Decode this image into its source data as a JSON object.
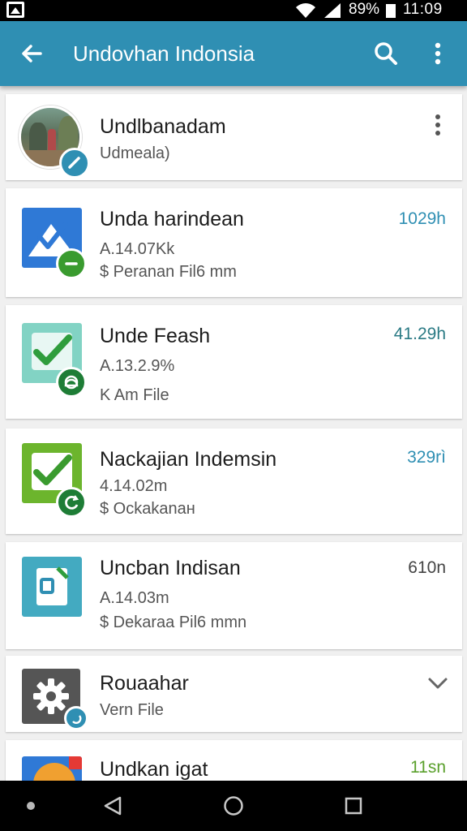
{
  "status_bar": {
    "battery_percent": "89%",
    "time": "11:09"
  },
  "app_bar": {
    "title": "Undovhan Indonsia",
    "back_icon": "arrow-back-icon",
    "search_icon": "search-icon",
    "more_icon": "more-vert-icon"
  },
  "account": {
    "name": "Undlbanadam",
    "subtitle": "Udmeala)"
  },
  "apps": [
    {
      "name": "Unda harindean",
      "line1": "A.14.07Kk",
      "line2": "$ Peranan Fil6 mm",
      "size": "1029h",
      "size_color": "#2f8fb3",
      "icon_color": "#2f79d6",
      "badge_color": "#3a9b2f"
    },
    {
      "name": "Unde Feash",
      "line1": "A.13.2.9%",
      "line2": "K Am File",
      "size": "41.29h",
      "size_color": "#2a7a84",
      "icon_color": "#82d3c4",
      "badge_color": "#1e7d36"
    },
    {
      "name": "Nackajian Indemsin",
      "line1": "4.14.02m",
      "line2": "$ Ockakanaн",
      "size": "329rì",
      "size_color": "#2f8fb3",
      "icon_color": "#6cb52d",
      "badge_color": "#1e7d36"
    },
    {
      "name": "Uncban Indisan",
      "line1": "A.14.03m",
      "line2": "$ Dekaraa Pil6 mmn",
      "size": "610n",
      "size_color": "#444444",
      "icon_color": "#43aac1"
    },
    {
      "name": "Rouaahar",
      "line2": "Vern File",
      "icon_color": "#555555",
      "badge_color": "#2f8fb3"
    },
    {
      "name": "Undkan igat",
      "size": "11sn",
      "size_color": "#5aa02c"
    }
  ]
}
